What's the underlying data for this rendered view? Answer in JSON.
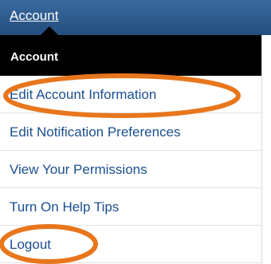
{
  "nav": {
    "account_link": "Account"
  },
  "menu": {
    "header": "Account",
    "items": [
      {
        "label": "Edit Account Information"
      },
      {
        "label": "Edit Notification Preferences"
      },
      {
        "label": "View Your Permissions"
      },
      {
        "label": "Turn On Help Tips"
      },
      {
        "label": "Logout"
      }
    ]
  },
  "annotation_color": "#e8761c"
}
